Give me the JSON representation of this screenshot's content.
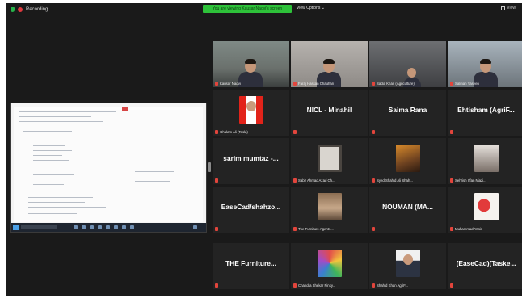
{
  "topbar": {
    "recording_label": "Recording",
    "banner": "You are viewing Kausar Naqvi's screen",
    "view_options": "View Options ⌄",
    "view_right": "View"
  },
  "participants": [
    {
      "id": "p1",
      "name": "Kausar Naqvi",
      "type": "video"
    },
    {
      "id": "p2",
      "name": "Faraj Hassan Chauhan",
      "type": "video"
    },
    {
      "id": "p3",
      "name": "Sadia Khan (Agriculture)",
      "type": "video"
    },
    {
      "id": "p4",
      "name": "Salman Yaseen",
      "type": "video"
    },
    {
      "id": "p5",
      "name": "Ghulam Ali (Tesla)",
      "type": "photo",
      "thumb": "flag"
    },
    {
      "id": "p6",
      "name": "NICL - Minahil",
      "type": "text"
    },
    {
      "id": "p7",
      "name": "Saima Rana",
      "type": "text"
    },
    {
      "id": "p8",
      "name": "Ehtisham (AgriF...",
      "type": "text"
    },
    {
      "id": "p9",
      "name": "sarim mumtaz -...",
      "type": "text"
    },
    {
      "id": "p10",
      "name": "Sabir Ahmad Azad Ch...",
      "type": "photo",
      "thumb": "logo"
    },
    {
      "id": "p11",
      "name": "Syed Shahid Ali Shah...",
      "type": "photo",
      "thumb": "photo1"
    },
    {
      "id": "p12",
      "name": "Sehrish Irfan Niazi...",
      "type": "photo",
      "thumb": "photo2"
    },
    {
      "id": "p13",
      "name": "EaseCad/shahzo...",
      "type": "text"
    },
    {
      "id": "p14",
      "name": "The Furniture Agents...",
      "type": "photo",
      "thumb": "sofa"
    },
    {
      "id": "p15",
      "name": "NOUMAN (MA...",
      "type": "text"
    },
    {
      "id": "p16",
      "name": "Muhammad Yasin",
      "type": "photo",
      "thumb": "flower"
    },
    {
      "id": "p17",
      "name": "THE Furniture...",
      "type": "text"
    },
    {
      "id": "p18",
      "name": "Chandra Shekar Pinky...",
      "type": "photo",
      "thumb": "colors"
    },
    {
      "id": "p19",
      "name": "Shahid Khan AgriF...",
      "type": "photo",
      "thumb": "portrait"
    },
    {
      "id": "p20",
      "name": "(EaseCad)(Taske...",
      "type": "text"
    }
  ]
}
